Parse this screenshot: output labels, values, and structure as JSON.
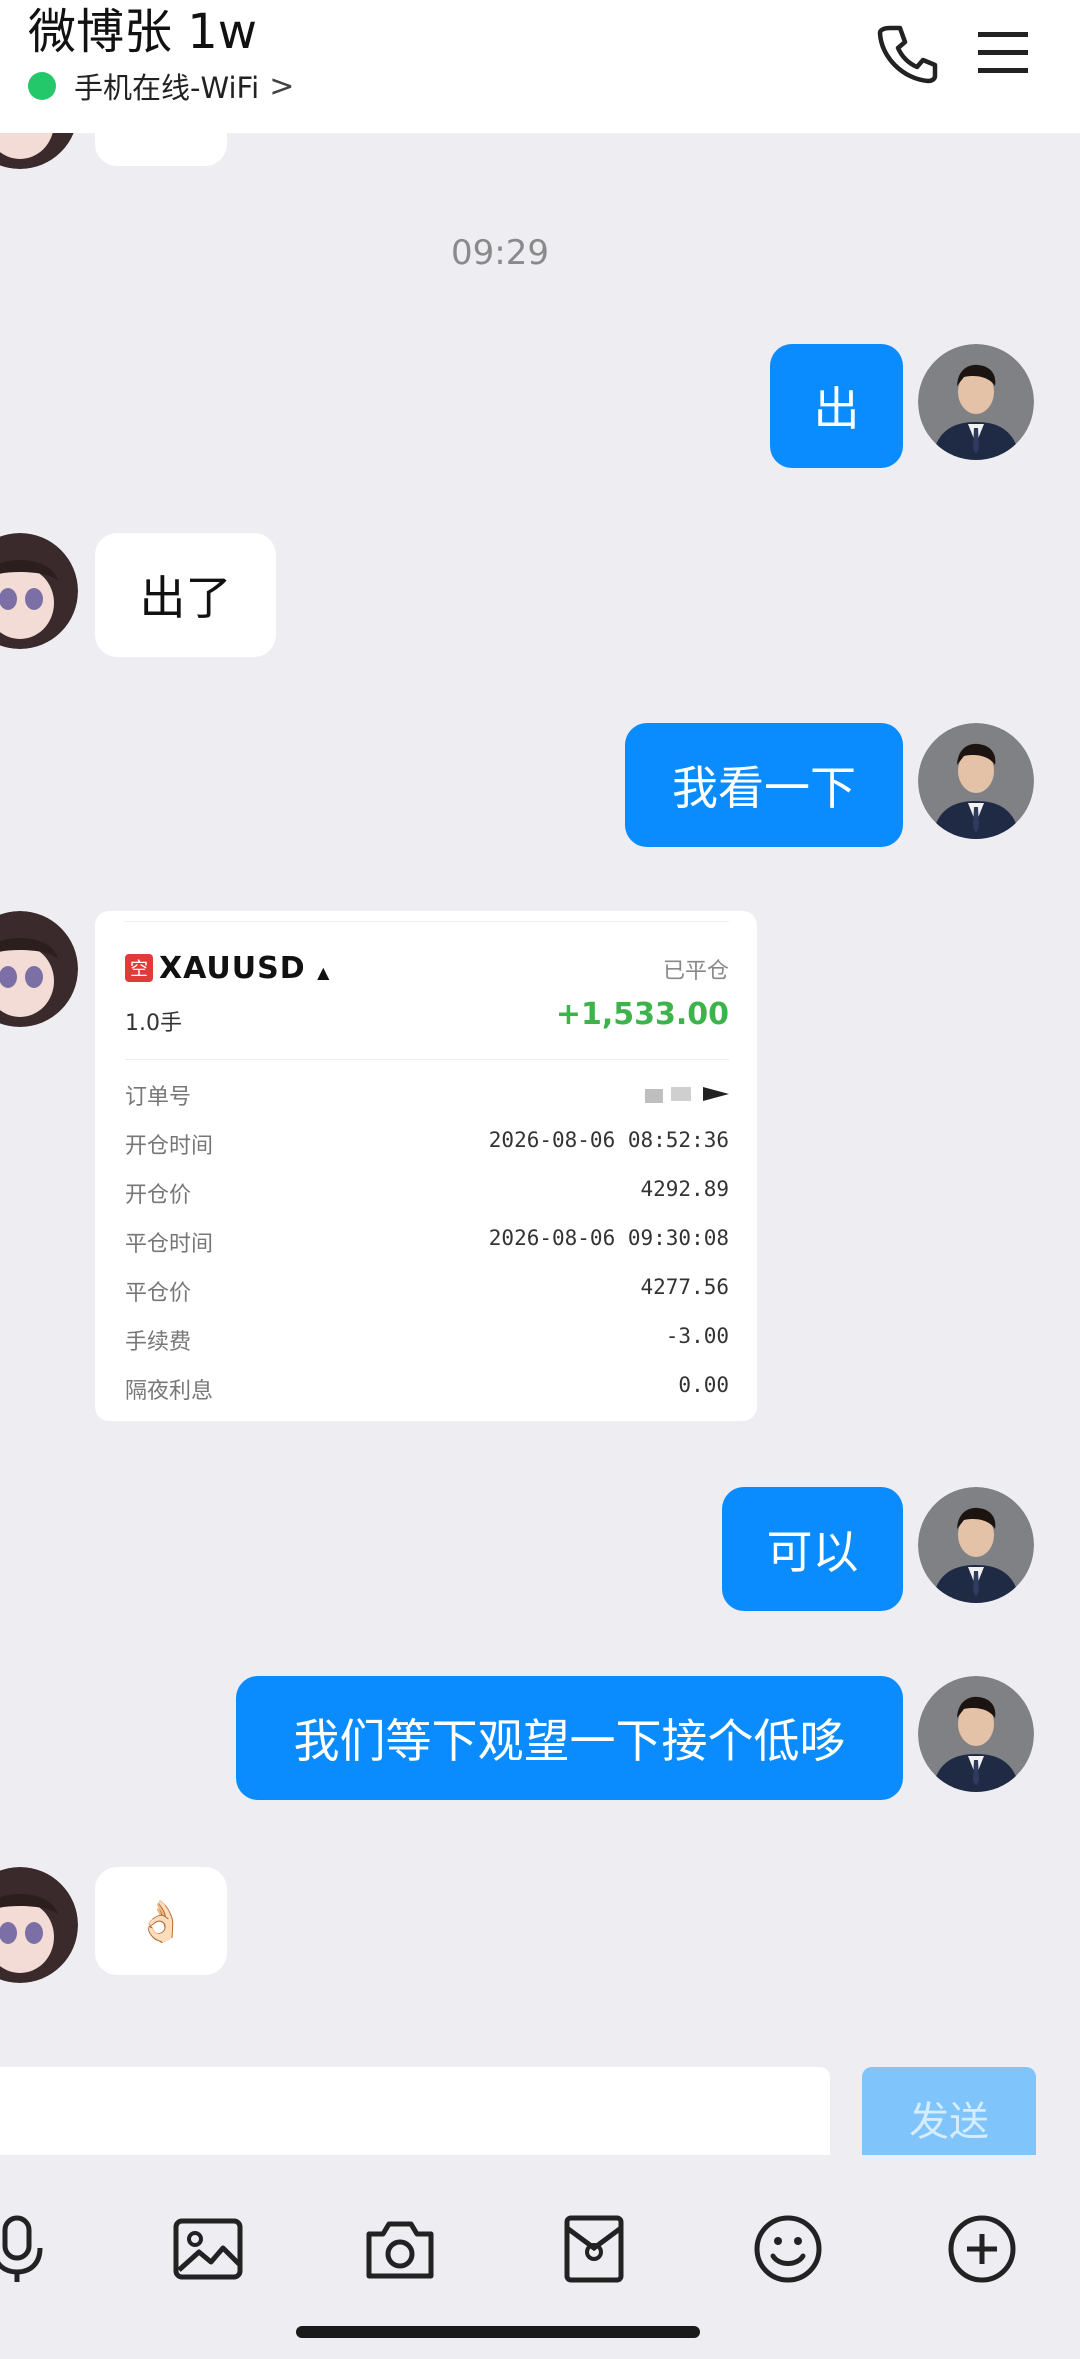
{
  "header": {
    "title": "微博张 1w",
    "status": "手机在线-WiFi",
    "status_chevron": ">",
    "icons": [
      "phone-icon",
      "menu-icon"
    ]
  },
  "chat": {
    "timestamp": "09:29",
    "messages": [
      {
        "side": "right",
        "text": "出"
      },
      {
        "side": "left",
        "text": "出了"
      },
      {
        "side": "right",
        "text": "我看一下"
      },
      {
        "side": "left",
        "type": "trade-card"
      },
      {
        "side": "right",
        "text": "可以"
      },
      {
        "side": "right",
        "text": "我们等下观望一下接个低哆"
      },
      {
        "side": "left",
        "text": "👌🏻"
      }
    ],
    "trade_card": {
      "badge": "空",
      "symbol": "XAUUSD",
      "status": "已平仓",
      "lots": "1.0手",
      "pnl": "+1,533.00",
      "rows": [
        {
          "label": "订单号",
          "value": ""
        },
        {
          "label": "开仓时间",
          "value": "2026-08-06 08:52:36"
        },
        {
          "label": "开仓价",
          "value": "4292.89"
        },
        {
          "label": "平仓时间",
          "value": "2026-08-06 09:30:08"
        },
        {
          "label": "平仓价",
          "value": "4277.56"
        },
        {
          "label": "手续费",
          "value": "-3.00"
        },
        {
          "label": "隔夜利息",
          "value": "0.00"
        }
      ]
    }
  },
  "input": {
    "placeholder": "",
    "send_label": "发送"
  },
  "toolbar": {
    "icons": [
      "microphone-icon",
      "image-icon",
      "camera-icon",
      "red-packet-icon",
      "emoji-icon",
      "plus-icon"
    ]
  },
  "colors": {
    "outgoing_bubble": "#0a8cff",
    "online_dot": "#23c86b",
    "profit_green": "#3cb44b",
    "send_button_disabled": "#7fc4fb"
  }
}
